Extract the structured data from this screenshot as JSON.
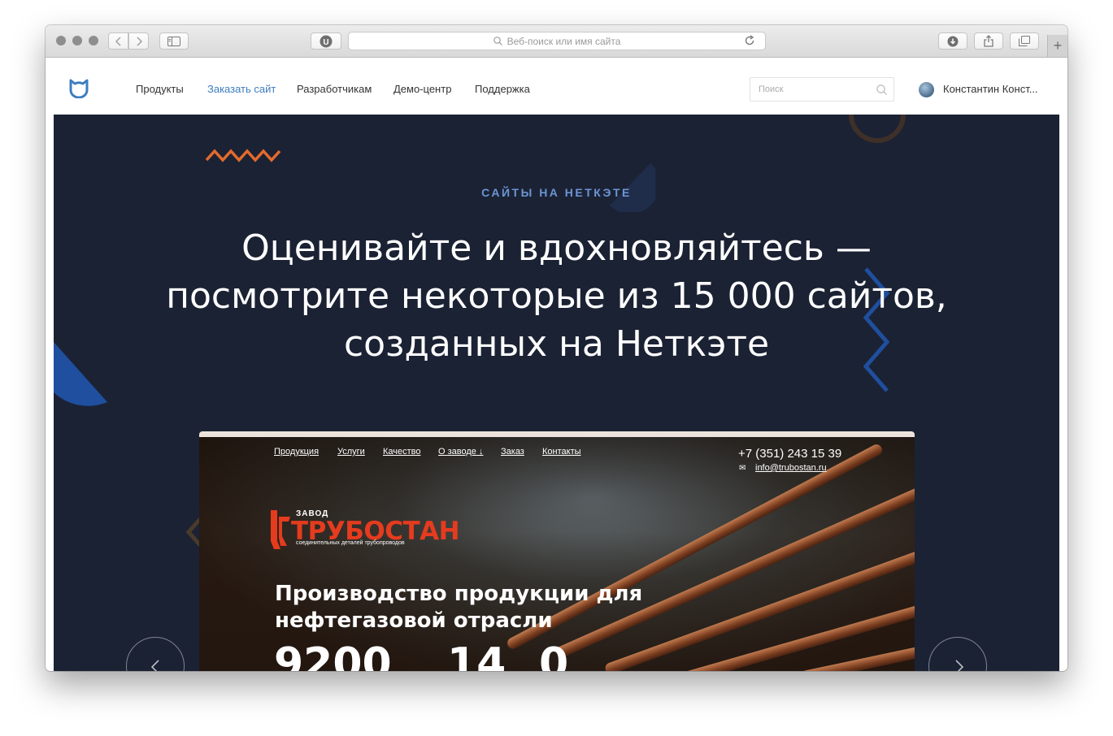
{
  "browser": {
    "address_placeholder": "Веб-поиск или имя сайта",
    "new_tab_symbol": "+"
  },
  "nav": {
    "items": [
      {
        "label": "Продукты",
        "active": false
      },
      {
        "label": "Заказать сайт",
        "active": true
      },
      {
        "label": "Разработчикам",
        "active": false
      },
      {
        "label": "Демо-центр",
        "active": false
      },
      {
        "label": "Поддержка",
        "active": false
      }
    ],
    "search_placeholder": "Поиск",
    "user_name": "Константин Конст..."
  },
  "hero": {
    "eyebrow": "САЙТЫ НА НЕТКЭТЕ",
    "headline_line1": "Оценивайте и вдохновляйтесь —",
    "headline_line2": "посмотрите некоторые из 15 000 сайтов,",
    "headline_line3": "созданных на Неткэте"
  },
  "showcase": {
    "nav": [
      "Продукция",
      "Услуги",
      "Качество",
      "О заводе ↓",
      "Заказ",
      "Контакты"
    ],
    "phone": "+7 (351) 243 15 39",
    "email": "info@trubostan.ru",
    "logo_small": "ЗАВОД",
    "logo_name": "ТРУБОСТАН",
    "logo_sub": "соединительных деталей трубопроводов",
    "title_line1": "Производство продукции для",
    "title_line2": "нефтегазовой отрасли",
    "numbers": [
      "9200",
      "14",
      "0"
    ]
  },
  "colors": {
    "hero_bg": "#1b2234",
    "accent_blue": "#3d7dc0",
    "eyebrow": "#6c95d4",
    "deco_orange": "#e46a2c",
    "deco_blue": "#1f4f9e",
    "logo_red": "#e53b1e"
  }
}
